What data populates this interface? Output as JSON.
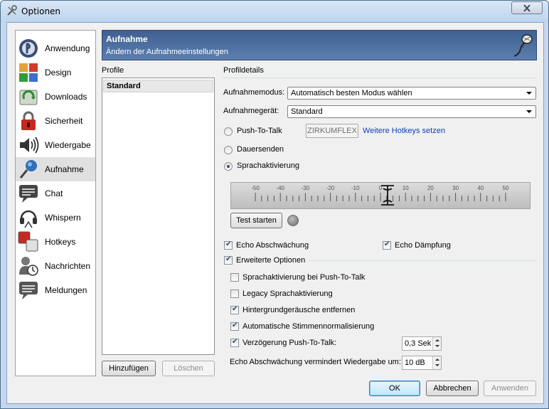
{
  "window": {
    "title": "Optionen"
  },
  "sidebar": {
    "items": [
      {
        "label": "Anwendung",
        "icon": "application-icon"
      },
      {
        "label": "Design",
        "icon": "design-icon"
      },
      {
        "label": "Downloads",
        "icon": "downloads-icon"
      },
      {
        "label": "Sicherheit",
        "icon": "security-lock-icon"
      },
      {
        "label": "Wiedergabe",
        "icon": "speaker-icon"
      },
      {
        "label": "Aufnahme",
        "icon": "microphone-icon",
        "active": true
      },
      {
        "label": "Chat",
        "icon": "chat-bubble-icon"
      },
      {
        "label": "Whispern",
        "icon": "headset-icon"
      },
      {
        "label": "Hotkeys",
        "icon": "keys-icon"
      },
      {
        "label": "Nachrichten",
        "icon": "messages-icon"
      },
      {
        "label": "Meldungen",
        "icon": "notifications-icon"
      }
    ]
  },
  "banner": {
    "title": "Aufnahme",
    "subtitle": "Ändern der Aufnahmeeinstellungen",
    "icon": "microphone-icon"
  },
  "profiles": {
    "heading": "Profile",
    "items": [
      "Standard"
    ],
    "add_label": "Hinzufügen",
    "delete_label": "Löschen"
  },
  "details": {
    "heading": "Profildetails",
    "mode_label": "Aufnahmemodus:",
    "mode_value": "Automatisch besten Modus wählen",
    "device_label": "Aufnahmegerät:",
    "device_value": "Standard",
    "ptt_label": "Push-To-Talk",
    "ptt_hotkey": "ZIRKUMFLEX",
    "more_hotkeys": "Weitere Hotkeys setzen",
    "continuous_label": "Dauersenden",
    "voice_activation_label": "Sprachaktivierung",
    "selected_mode": "Sprachaktivierung",
    "scale_ticks": [
      "-50",
      "-40",
      "-30",
      "-20",
      "-10",
      "0",
      "10",
      "20",
      "30",
      "40",
      "50"
    ],
    "threshold": 0,
    "test_label": "Test starten",
    "echo_reduction_label": "Echo Abschwächung",
    "echo_reduction": true,
    "echo_cancel_label": "Echo Dämpfung",
    "echo_cancel": true,
    "advanced_label": "Erweiterte Optionen",
    "advanced": true,
    "adv_ptt_label": "Sprachaktivierung bei Push-To-Talk",
    "adv_ptt": false,
    "legacy_label": "Legacy Sprachaktivierung",
    "legacy": false,
    "noise_label": "Hintergrundgeräusche entfernen",
    "noise": true,
    "normalize_label": "Automatische Stimmennormalisierung",
    "normalize": true,
    "delay_label": "Verzögerung Push-To-Talk:",
    "delay": true,
    "delay_value": "0,3 Sek",
    "echo_reduce_by_label": "Echo Abschwächung vermindert Wiedergabe um:",
    "echo_reduce_by_value": "10 dB"
  },
  "footer": {
    "ok_label": "OK",
    "cancel_label": "Abbrechen",
    "apply_label": "Anwenden"
  }
}
